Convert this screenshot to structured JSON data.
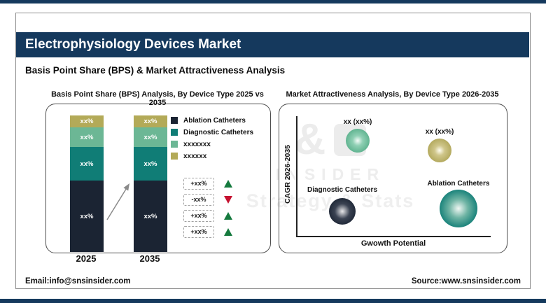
{
  "header": {
    "title": "Electrophysiology Devices Market",
    "subtitle": "Basis Point Share (BPS) & Market Attractiveness Analysis"
  },
  "palette": {
    "accent_navy": "#15395d",
    "bar_navy": "#1b2433",
    "teal": "#107d76",
    "seafoam": "#6cb795",
    "khaki": "#b3aa58",
    "up_green": "#157a3e",
    "down_red": "#c51230"
  },
  "watermark": {
    "amp": "&",
    "insider": "INSIDER",
    "tagline": "Strategy & Stats"
  },
  "bps": {
    "title": "Basis Point Share (BPS) Analysis, By Device Type 2025 vs 2035",
    "bars": [
      {
        "year": "2025",
        "segments": [
          {
            "label": "xx%"
          },
          {
            "label": "xx%"
          },
          {
            "label": "xx%"
          },
          {
            "label": "xx%"
          }
        ]
      },
      {
        "year": "2035",
        "segments": [
          {
            "label": "xx%"
          },
          {
            "label": "xx%"
          },
          {
            "label": "xx%"
          },
          {
            "label": "xx%"
          }
        ]
      }
    ],
    "legend": [
      {
        "label": "Ablation Catheters",
        "color": "#1b2433"
      },
      {
        "label": "Diagnostic Catheters",
        "color": "#107d76"
      },
      {
        "label": "xxxxxxx",
        "color": "#6cb795"
      },
      {
        "label": "xxxxxx",
        "color": "#b3aa58"
      }
    ],
    "deltas": [
      {
        "label": "+xx%",
        "direction": "up"
      },
      {
        "label": "-xx%",
        "direction": "down"
      },
      {
        "label": "+xx%",
        "direction": "up"
      },
      {
        "label": "+xx%",
        "direction": "up"
      }
    ]
  },
  "attract": {
    "title": "Market Attractiveness Analysis, By Device Type 2026-2035",
    "y_axis": "CAGR 2026-2035",
    "x_axis": "Gwowth Potential",
    "bubbles": [
      {
        "label": "xx (xx%)",
        "color": "#5cb18d"
      },
      {
        "label": "xx (xx%)",
        "color": "#b1a75a"
      },
      {
        "label": "Diagnostic Catheters",
        "color": "#1b2433"
      },
      {
        "label": "Ablation Catheters",
        "color": "#107d76"
      }
    ]
  },
  "footer": {
    "email": "Email:info@snsinsider.com",
    "source": "Source:www.snsinsider.com"
  },
  "chart_data": [
    {
      "type": "bar",
      "variant": "stacked-column",
      "title": "Basis Point Share (BPS) Analysis, By Device Type 2025 vs 2035",
      "categories": [
        "2025",
        "2035"
      ],
      "series": [
        {
          "name": "Ablation Catheters",
          "color": "#1b2433",
          "values": [
            "xx%",
            "xx%"
          ],
          "approx_share_of_bar": [
            0.51,
            0.51
          ]
        },
        {
          "name": "Diagnostic Catheters",
          "color": "#107d76",
          "values": [
            "xx%",
            "xx%"
          ],
          "approx_share_of_bar": [
            0.25,
            0.25
          ]
        },
        {
          "name": "xxxxxxx",
          "color": "#6cb795",
          "values": [
            "xx%",
            "xx%"
          ],
          "approx_share_of_bar": [
            0.15,
            0.15
          ]
        },
        {
          "name": "xxxxxx",
          "color": "#b3aa58",
          "values": [
            "xx%",
            "xx%"
          ],
          "approx_share_of_bar": [
            0.09,
            0.09
          ]
        }
      ],
      "annotations": {
        "trend_arrow": "up-right between bars",
        "change_badges": [
          {
            "label": "+xx%",
            "direction": "up",
            "color": "#157a3e"
          },
          {
            "label": "-xx%",
            "direction": "down",
            "color": "#c51230"
          },
          {
            "label": "+xx%",
            "direction": "up",
            "color": "#157a3e"
          },
          {
            "label": "+xx%",
            "direction": "up",
            "color": "#157a3e"
          }
        ]
      },
      "legend_position": "right",
      "grid": false
    },
    {
      "type": "scatter",
      "variant": "bubble",
      "title": "Market Attractiveness Analysis, By Device Type 2026-2035",
      "xlabel": "Gwowth Potential",
      "ylabel": "CAGR 2026-2035",
      "points": [
        {
          "label": "xx (xx%)",
          "color": "#5cb18d",
          "growth_potential": 0.3,
          "cagr": 0.8,
          "bubble_radius_px": 17
        },
        {
          "label": "xx (xx%)",
          "color": "#b1a75a",
          "growth_potential": 0.72,
          "cagr": 0.72,
          "bubble_radius_px": 17
        },
        {
          "label": "Diagnostic Catheters",
          "color": "#1b2433",
          "growth_potential": 0.23,
          "cagr": 0.2,
          "bubble_radius_px": 19
        },
        {
          "label": "Ablation Catheters",
          "color": "#107d76",
          "growth_potential": 0.83,
          "cagr": 0.22,
          "bubble_radius_px": 27
        }
      ],
      "grid": false,
      "axis_ranges": "unlabeled qualitative axes"
    }
  ]
}
